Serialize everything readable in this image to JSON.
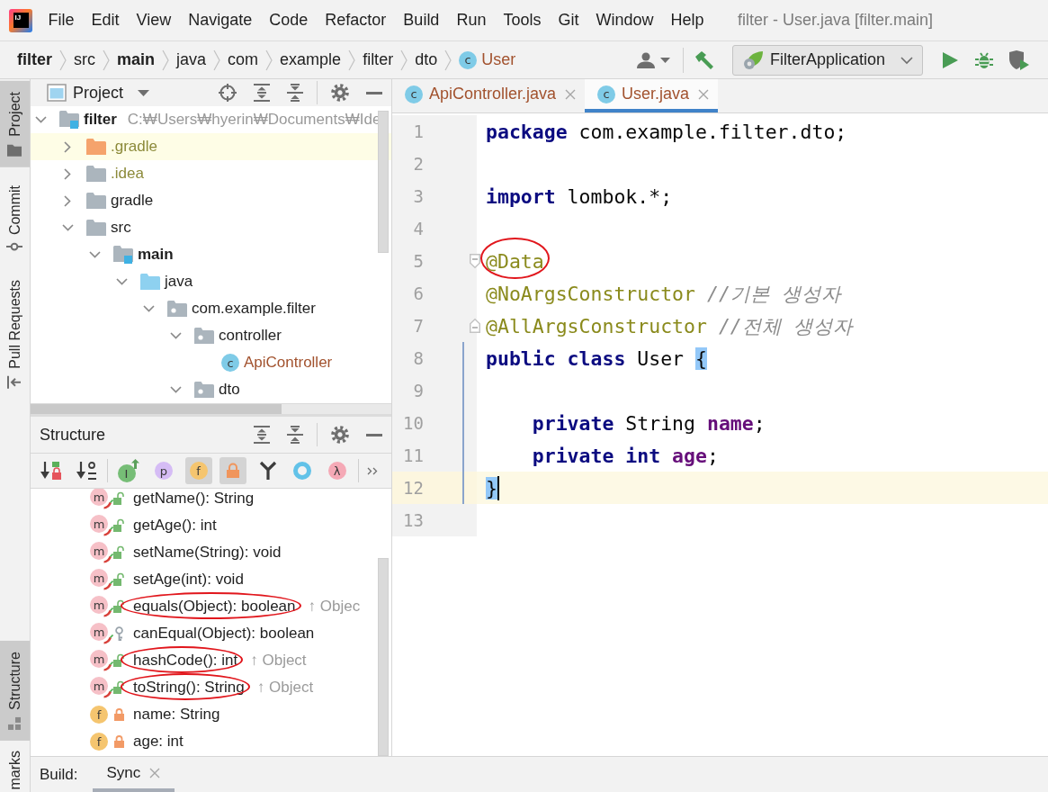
{
  "menu_bar": {
    "logo": "IJ",
    "items": [
      "File",
      "Edit",
      "View",
      "Navigate",
      "Code",
      "Refactor",
      "Build",
      "Run",
      "Tools",
      "Git",
      "Window",
      "Help"
    ],
    "title": "filter - User.java [filter.main]"
  },
  "nav_bar": {
    "breadcrumbs": [
      {
        "label": "filter",
        "kind": "module"
      },
      {
        "label": "src",
        "kind": "folder"
      },
      {
        "label": "main",
        "kind": "module"
      },
      {
        "label": "java",
        "kind": "folder"
      },
      {
        "label": "com",
        "kind": "folder"
      },
      {
        "label": "example",
        "kind": "folder"
      },
      {
        "label": "filter",
        "kind": "folder"
      },
      {
        "label": "dto",
        "kind": "folder"
      },
      {
        "label": "User",
        "kind": "class",
        "badge": "c",
        "color": "#a2522e"
      }
    ],
    "run_config": "FilterApplication"
  },
  "tool_stripe": {
    "top": [
      {
        "label": "Project",
        "selected": true
      },
      {
        "label": "Commit",
        "selected": false
      },
      {
        "label": "Pull Requests",
        "selected": false
      }
    ],
    "bottom": [
      {
        "label": "Structure",
        "selected": true
      },
      {
        "label": "marks",
        "selected": false
      }
    ]
  },
  "project_panel": {
    "title": "Project",
    "tree": [
      {
        "name": "filter",
        "kind": "module",
        "path": "C:₩Users₩hyerin₩Documents₩Ide",
        "expanded": true,
        "highlighted": false,
        "children": [
          {
            "name": ".gradle",
            "kind": "excluded",
            "color": "#8c8a3a",
            "expanded": false,
            "highlighted": true
          },
          {
            "name": ".idea",
            "kind": "folder",
            "color": "#8c8a3a",
            "expanded": false,
            "highlighted": false
          },
          {
            "name": "gradle",
            "kind": "folder",
            "expanded": false,
            "highlighted": false
          },
          {
            "name": "src",
            "kind": "folder",
            "expanded": true,
            "highlighted": false,
            "children": [
              {
                "name": "main",
                "kind": "module",
                "expanded": true,
                "highlighted": false,
                "children": [
                  {
                    "name": "java",
                    "kind": "source",
                    "expanded": true,
                    "highlighted": false,
                    "children": [
                      {
                        "name": "com.example.filter",
                        "kind": "package",
                        "expanded": true,
                        "highlighted": false,
                        "children": [
                          {
                            "name": "controller",
                            "kind": "package",
                            "expanded": true,
                            "highlighted": false,
                            "children": [
                              {
                                "name": "ApiController",
                                "kind": "class",
                                "badge": "c",
                                "color": "#a2522e",
                                "highlighted": false
                              }
                            ]
                          },
                          {
                            "name": "dto",
                            "kind": "package",
                            "expanded": true,
                            "highlighted": false
                          }
                        ]
                      }
                    ]
                  }
                ]
              }
            ]
          }
        ]
      }
    ]
  },
  "structure_panel": {
    "title": "Structure",
    "filters": [
      {
        "selected": false
      },
      {
        "selected": false
      },
      {
        "glyph": "I",
        "selected": false
      },
      {
        "glyph": "p",
        "selected": false
      },
      {
        "glyph": "f",
        "selected": true
      },
      {
        "selected": true
      },
      {
        "selected": false
      },
      {
        "selected": false
      },
      {
        "glyph": "λ",
        "selected": false
      }
    ],
    "items": [
      {
        "kind": "method",
        "badge": "m",
        "generated": true,
        "access": {
          "kind": "public"
        },
        "label": "getName(): String",
        "circled": false
      },
      {
        "kind": "method",
        "badge": "m",
        "generated": true,
        "access": {
          "kind": "public"
        },
        "label": "getAge(): int",
        "circled": false
      },
      {
        "kind": "method",
        "badge": "m",
        "generated": true,
        "access": {
          "kind": "public"
        },
        "label": "setName(String): void",
        "circled": false
      },
      {
        "kind": "method",
        "badge": "m",
        "generated": true,
        "access": {
          "kind": "public"
        },
        "label": "setAge(int): void",
        "circled": false
      },
      {
        "kind": "method",
        "badge": "m",
        "generated": true,
        "access": {
          "kind": "public"
        },
        "label": "equals(Object): boolean",
        "inherited": "↑ Objec",
        "circled": true
      },
      {
        "kind": "method",
        "badge": "m",
        "generated": true,
        "access": {
          "kind": "protected"
        },
        "label": "canEqual(Object): boolean",
        "circled": false
      },
      {
        "kind": "method",
        "badge": "m",
        "generated": true,
        "access": {
          "kind": "public"
        },
        "label": "hashCode(): int",
        "inherited": "↑ Object",
        "circled": true
      },
      {
        "kind": "method",
        "badge": "m",
        "generated": true,
        "access": {
          "kind": "public"
        },
        "label": "toString(): String",
        "inherited": "↑ Object",
        "circled": true
      },
      {
        "kind": "field",
        "badge": "f",
        "generated": false,
        "access": {
          "kind": "private"
        },
        "label": "name: String",
        "circled": false
      },
      {
        "kind": "field",
        "badge": "f",
        "generated": false,
        "access": {
          "kind": "private"
        },
        "label": "age: int",
        "circled": false
      }
    ]
  },
  "editor": {
    "tabs": [
      {
        "label": "ApiController.java",
        "badge": "c",
        "color": "#a2522e",
        "selected": false
      },
      {
        "label": "User.java",
        "badge": "c",
        "color": "#a2522e",
        "selected": true
      }
    ],
    "lines": [
      {
        "number": "1",
        "current": false,
        "scope": false,
        "caret": false,
        "tokens": [
          {
            "text": "package",
            "kind": "keyword"
          },
          {
            "text": " com.example.filter.dto;",
            "kind": "plain"
          }
        ]
      },
      {
        "number": "2",
        "current": false,
        "scope": false,
        "caret": false
      },
      {
        "number": "3",
        "current": false,
        "scope": false,
        "caret": false,
        "tokens": [
          {
            "text": "import",
            "kind": "keyword"
          },
          {
            "text": " lombok.*;",
            "kind": "plain"
          }
        ]
      },
      {
        "number": "4",
        "current": false,
        "scope": false,
        "caret": false
      },
      {
        "number": "5",
        "current": false,
        "scope": false,
        "caret": false,
        "fold": {
          "kind": "start"
        },
        "tokens": [
          {
            "text": "@Data",
            "kind": "annotation",
            "circled": true
          }
        ]
      },
      {
        "number": "6",
        "current": false,
        "scope": false,
        "caret": false,
        "tokens": [
          {
            "text": "@NoArgsConstructor",
            "kind": "annotation"
          },
          {
            "text": " //기본 생성자",
            "kind": "comment"
          }
        ]
      },
      {
        "number": "7",
        "current": false,
        "scope": false,
        "caret": false,
        "fold": {
          "kind": "end"
        },
        "tokens": [
          {
            "text": "@AllArgsConstructor",
            "kind": "annotation"
          },
          {
            "text": " //전체 생성자",
            "kind": "comment"
          }
        ]
      },
      {
        "number": "8",
        "current": false,
        "scope": true,
        "caret": false,
        "tokens": [
          {
            "text": "public class",
            "kind": "keyword"
          },
          {
            "text": " User ",
            "kind": "plain"
          },
          {
            "text": "{",
            "kind": "brace"
          }
        ]
      },
      {
        "number": "9",
        "current": false,
        "scope": true,
        "caret": false
      },
      {
        "number": "10",
        "current": false,
        "scope": true,
        "caret": false,
        "tokens": [
          {
            "text": "    private",
            "kind": "keyword"
          },
          {
            "text": " String ",
            "kind": "plain"
          },
          {
            "text": "name",
            "kind": "field"
          },
          {
            "text": ";",
            "kind": "plain"
          }
        ]
      },
      {
        "number": "11",
        "current": false,
        "scope": true,
        "caret": false,
        "tokens": [
          {
            "text": "    private int ",
            "kind": "keyword"
          },
          {
            "text": "age",
            "kind": "field"
          },
          {
            "text": ";",
            "kind": "plain"
          }
        ]
      },
      {
        "number": "12",
        "current": true,
        "scope": true,
        "caret": true,
        "tokens": [
          {
            "text": "}",
            "kind": "brace"
          }
        ]
      },
      {
        "number": "13",
        "current": false,
        "scope": false,
        "caret": false
      }
    ]
  },
  "bottom_bar": {
    "label": "Build:",
    "tabs": [
      {
        "label": "Sync",
        "selected": true
      }
    ]
  }
}
